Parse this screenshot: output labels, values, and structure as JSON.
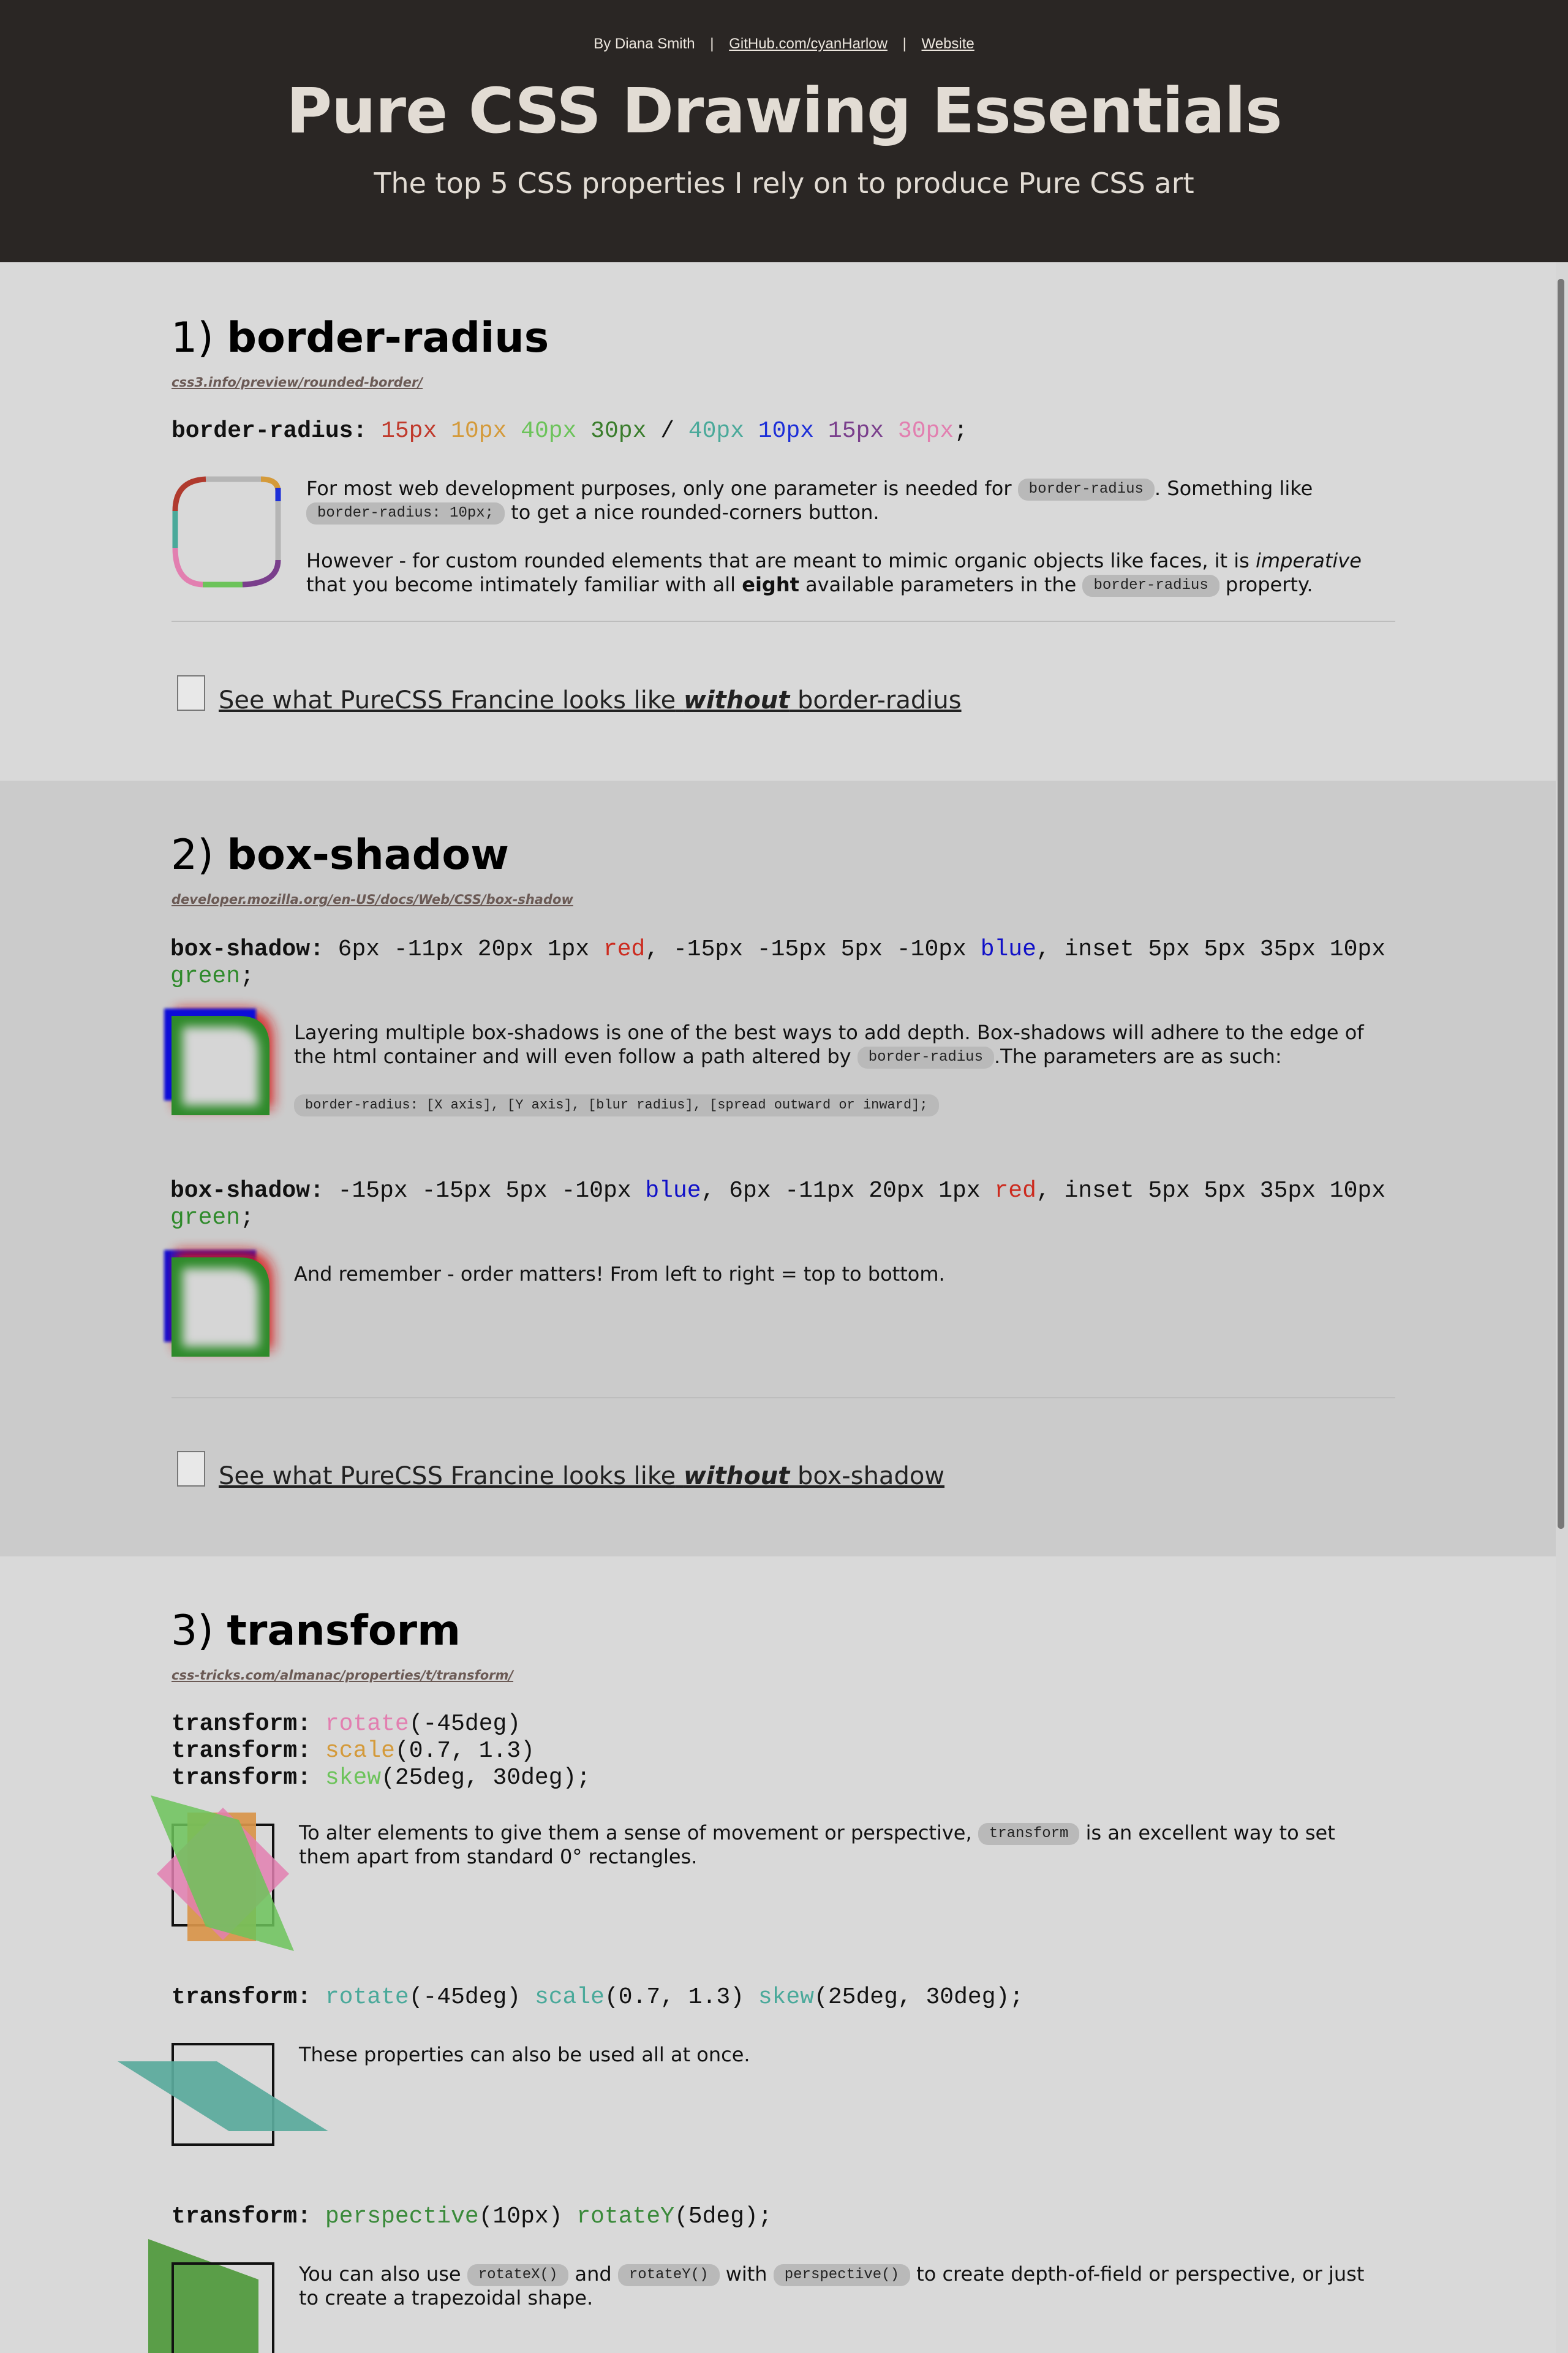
{
  "header": {
    "byline_author": "By Diana Smith",
    "byline_sep1": "|",
    "byline_github": "GitHub.com/cyanHarlow",
    "byline_sep2": "|",
    "byline_website": "Website",
    "title": "Pure CSS Drawing Essentials",
    "subtitle": "The top 5 CSS properties I rely on to produce Pure CSS art"
  },
  "section1": {
    "number": "1)",
    "heading": "border-radius",
    "ref_link": "css3.info/preview/rounded-border/",
    "code": {
      "prop": "border-radius",
      "colon": ":",
      "v1": "15px",
      "v2": "10px",
      "v3": "40px",
      "v4": "30px",
      "slash": "/",
      "v5": "40px",
      "v6": "10px",
      "v7": "15px",
      "v8": "30px",
      "semi": ";"
    },
    "p1_a": "For most web development purposes, only one parameter is needed for",
    "p1_pill1": "border-radius",
    "p1_b": ". Something like",
    "p1_pill2": "border-radius: 10px;",
    "p1_c": "to get a nice rounded-corners button.",
    "p2_a": "However - for custom rounded elements that are meant to mimic organic objects like faces, it is",
    "p2_em": "imperative",
    "p2_b": "that you become intimately familiar with all",
    "p2_strong": "eight",
    "p2_c": "available parameters in the",
    "p2_pill": "border-radius",
    "p2_d": "property.",
    "checkbox_a": "See what PureCSS Francine looks like",
    "checkbox_em": "without",
    "checkbox_b": "border-radius"
  },
  "section2": {
    "number": "2)",
    "heading": "box-shadow",
    "ref_link": "developer.mozilla.org/en-US/docs/Web/CSS/box-shadow",
    "code1": {
      "prop": "box-shadow",
      "colon": ":",
      "a": "6px -11px 20px 1px",
      "red": "red",
      "b": ", -15px -15px 5px -10px",
      "blue": "blue",
      "c": ", inset 5px 5px 35px",
      "d": "10px",
      "green": "green",
      "semi": ";"
    },
    "p1_a": "Layering multiple box-shadows is one of the best ways to add depth. Box-shadows will adhere to the edge of the html container and will even follow a path altered by",
    "p1_pill": "border-radius",
    "p1_b": ".The parameters are as such:",
    "params_pill": "border-radius: [X axis], [Y axis], [blur radius], [spread outward or inward];",
    "code2": {
      "prop": "box-shadow",
      "colon": ":",
      "a": "-15px -15px 5px -10px",
      "blue": "blue",
      "b": ", 6px -11px 20px 1px",
      "red": "red",
      "c": ", inset 5px 5px 35px",
      "d": "10px",
      "green": "green",
      "semi": ";"
    },
    "p2": "And remember - order matters! From left to right = top to bottom.",
    "checkbox_a": "See what PureCSS Francine looks like",
    "checkbox_em": "without",
    "checkbox_b": "box-shadow"
  },
  "section3": {
    "number": "3)",
    "heading": "transform",
    "ref_link": "css-tricks.com/almanac/properties/t/transform/",
    "code1": {
      "prop": "transform",
      "colon": ":",
      "fn1": "rotate",
      "arg1": "(-45deg)",
      "fn2": "scale",
      "arg2": "(0.7, 1.3)",
      "fn3": "skew",
      "arg3": "(25deg, 30deg);"
    },
    "p1_a": "To alter elements to give them a sense of movement or perspective,",
    "p1_pill": "transform",
    "p1_b": "is an excellent way to set them apart from standard 0° rectangles.",
    "code2": {
      "prop": "transform",
      "colon": ":",
      "fn1": "rotate",
      "arg1": "(-45deg)",
      "fn2": "scale",
      "arg2": "(0.7, 1.3)",
      "fn3": "skew",
      "arg3": "(25deg, 30deg);"
    },
    "p2": "These properties can also be used all at once.",
    "code3": {
      "prop": "transform",
      "colon": ":",
      "fn1": "perspective",
      "arg1": "(10px)",
      "fn2": "rotateY",
      "arg2": "(5deg);"
    },
    "p3_a": "You can also use",
    "p3_pill1": "rotateX()",
    "p3_b": "and",
    "p3_pill2": "rotateY()",
    "p3_c": "with",
    "p3_pill3": "perspective()",
    "p3_d": "to create depth-of-field or perspective, or just to create a trapezoidal shape."
  },
  "icons": {
    "demo1": "border-radius-demo-icon",
    "demo2": "box-shadow-demo-icon",
    "demo3": "box-shadow-reordered-demo-icon",
    "demo4": "transform-individual-demo-icon",
    "demo5": "transform-combined-demo-icon",
    "demo6": "perspective-demo-icon"
  },
  "colors": {
    "header_bg": "#2a2624",
    "section_light": "#d9d9d9",
    "section_dark": "#cbcbcb",
    "ref_link": "#6b5a55"
  }
}
